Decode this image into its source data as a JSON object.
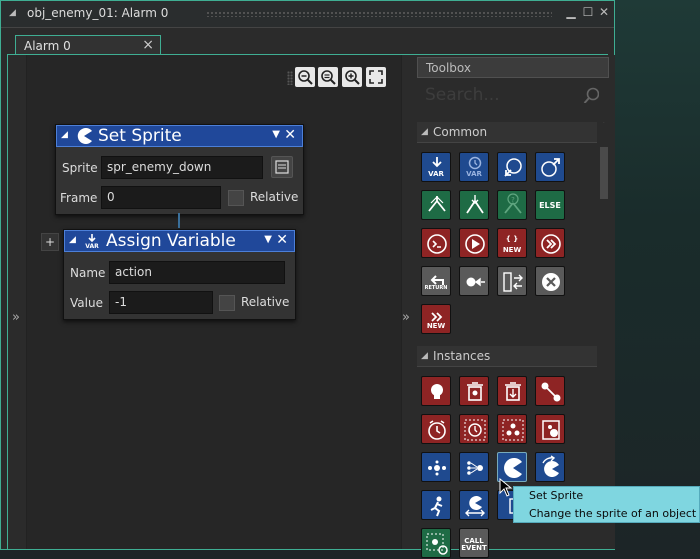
{
  "window": {
    "title": "obj_enemy_01: Alarm 0"
  },
  "tab": {
    "label": "Alarm 0"
  },
  "zoom_buttons": [
    "zoom-out",
    "zoom-reset",
    "zoom-in",
    "fullscreen"
  ],
  "blocks": {
    "set_sprite": {
      "title": "Set Sprite",
      "sprite_label": "Sprite",
      "sprite_value": "spr_enemy_down",
      "frame_label": "Frame",
      "frame_value": "0",
      "relative_label": "Relative",
      "relative_checked": false
    },
    "assign_variable": {
      "title": "Assign Variable",
      "name_label": "Name",
      "name_value": "action",
      "value_label": "Value",
      "value_value": "-1",
      "relative_label": "Relative",
      "relative_checked": false
    }
  },
  "toolbox": {
    "header": "Toolbox",
    "search_placeholder": "Search...",
    "sections": {
      "common": {
        "label": "Common",
        "labels": [
          "VAR",
          "VAR",
          "RETURN",
          "NEW",
          "ELSE",
          "NEW"
        ]
      },
      "instances": {
        "label": "Instances",
        "labels": [
          "CALL",
          "EVENT"
        ]
      }
    }
  },
  "tooltip": {
    "title": "Set Sprite",
    "description": "Change the sprite of an object"
  },
  "colors": {
    "accent": "#3fae93",
    "block_header": "#20489a",
    "icon_blue": "#1f4a8f",
    "icon_green": "#1e6b45",
    "icon_red": "#8e2424",
    "icon_grey": "#5a5a5a",
    "tooltip_bg": "#7fd6e0"
  }
}
